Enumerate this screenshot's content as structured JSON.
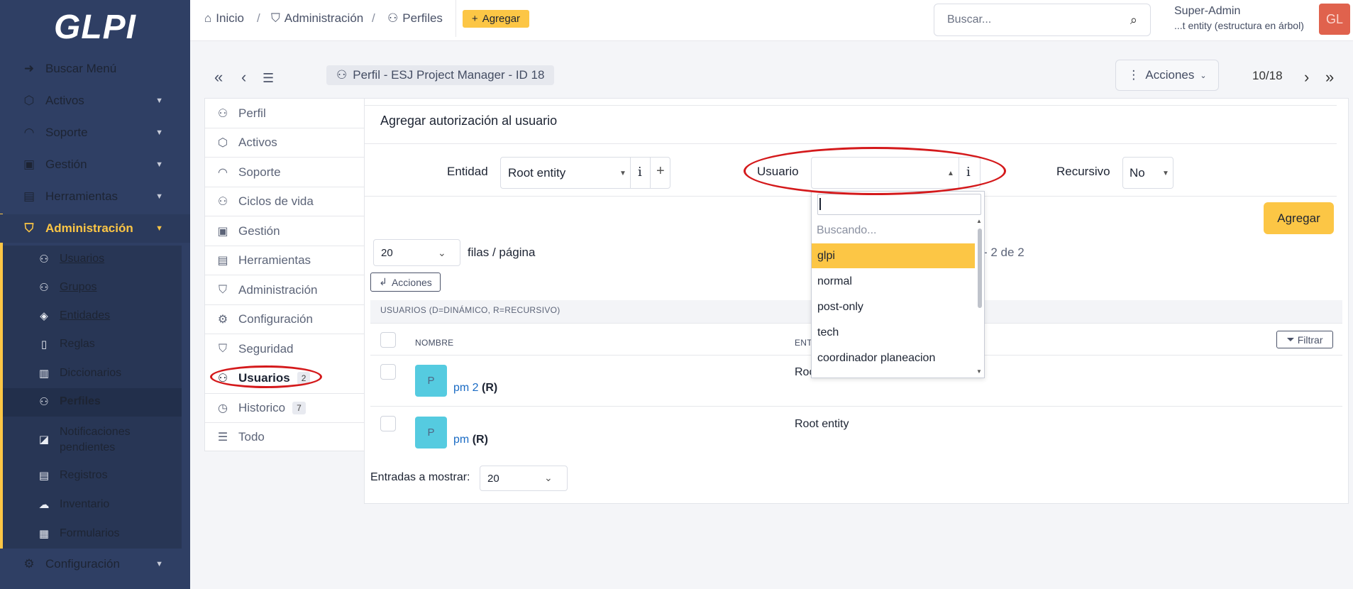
{
  "app": {
    "logo": "GLPI"
  },
  "sidebar": {
    "items": [
      {
        "label": "Buscar Menú",
        "icon": "arrow-right-icon"
      },
      {
        "label": "Activos",
        "icon": "box-icon"
      },
      {
        "label": "Soporte",
        "icon": "headset-icon"
      },
      {
        "label": "Gestión",
        "icon": "wallet-icon"
      },
      {
        "label": "Herramientas",
        "icon": "briefcase-icon"
      },
      {
        "label": "Administración",
        "icon": "shield-icon"
      }
    ],
    "admin_subitems": [
      {
        "label": "Usuarios",
        "icon": "user-icon"
      },
      {
        "label": "Grupos",
        "icon": "users-icon"
      },
      {
        "label": "Entidades",
        "icon": "layers-icon"
      },
      {
        "label": "Reglas",
        "icon": "book-icon"
      },
      {
        "label": "Diccionarios",
        "icon": "book-open-icon"
      },
      {
        "label": "Perfiles",
        "icon": "user-check-icon"
      },
      {
        "label": "Notificaciones pendientes",
        "icon": "bell-icon"
      },
      {
        "label": "Registros",
        "icon": "list-icon"
      },
      {
        "label": "Inventario",
        "icon": "cloud-download-icon"
      },
      {
        "label": "Formularios",
        "icon": "forms-icon"
      }
    ],
    "configuracion": "Configuración"
  },
  "header": {
    "breadcrumbs": [
      "Inicio",
      "Administración",
      "Perfiles"
    ],
    "add_label": "Agregar",
    "search_placeholder": "Buscar...",
    "user_name": "Super-Admin",
    "user_entity": "...t entity (estructura en árbol)",
    "avatar_initials": "GL"
  },
  "record": {
    "title": "Perfil -  ESJ Project Manager - ID 18",
    "actions_label": "Acciones",
    "position": "10/18"
  },
  "tabs": [
    {
      "label": "Perfil",
      "icon": "user-icon"
    },
    {
      "label": "Activos",
      "icon": "box-icon"
    },
    {
      "label": "Soporte",
      "icon": "headset-icon"
    },
    {
      "label": "Ciclos de vida",
      "icon": "cycle-icon"
    },
    {
      "label": "Gestión",
      "icon": "wallet-icon"
    },
    {
      "label": "Herramientas",
      "icon": "briefcase-icon"
    },
    {
      "label": "Administración",
      "icon": "shield-icon"
    },
    {
      "label": "Configuración",
      "icon": "gear-icon"
    },
    {
      "label": "Seguridad",
      "icon": "shield-lock-icon"
    },
    {
      "label": "Usuarios",
      "icon": "user-icon",
      "count": "2"
    },
    {
      "label": "Historico",
      "icon": "history-icon",
      "count": "7"
    },
    {
      "label": "Todo",
      "icon": "stack-icon"
    }
  ],
  "form": {
    "title": "Agregar autorización al usuario",
    "entidad_label": "Entidad",
    "entidad_value": "Root entity",
    "usuario_label": "Usuario",
    "usuario_value": "",
    "recursivo_label": "Recursivo",
    "recursivo_value": "No",
    "submit_label": "Agregar"
  },
  "dropdown": {
    "searching": "Buscando...",
    "options": [
      "glpi",
      "normal",
      "post-only",
      "tech",
      "coordinador planeacion"
    ]
  },
  "list": {
    "rows_per_page": "20",
    "rows_label": "filas / página",
    "pagination_text": "- 2 de 2",
    "actions_label": "Acciones",
    "caption": "USUARIOS (D=DINÁMICO, R=RECURSIVO)",
    "col_name": "NOMBRE",
    "col_entity": "ENT",
    "filter_label": "Filtrar",
    "rows": [
      {
        "initial": "P",
        "name": "pm 2",
        "flag": "(R)",
        "entity": "Roo"
      },
      {
        "initial": "P",
        "name": "pm",
        "flag": "(R)",
        "entity": "Root entity"
      }
    ],
    "entries_label": "Entradas a mostrar:",
    "entries_value": "20"
  },
  "colors": {
    "sidebar": "#2f3f64",
    "accent": "#fcc645",
    "annotation": "#d4191b"
  }
}
